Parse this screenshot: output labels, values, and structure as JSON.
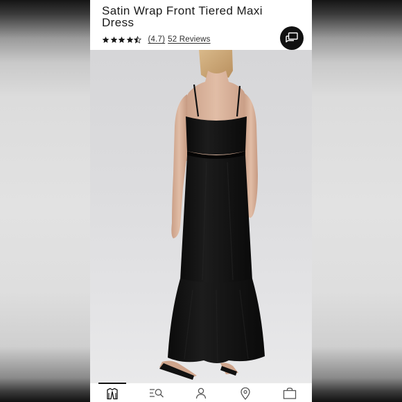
{
  "product": {
    "title": "Satin Wrap Front Tiered Maxi Dress",
    "rating_value": 4.7,
    "rating_text": "(4.7)",
    "reviews_text": "52 Reviews",
    "stars": [
      "full",
      "full",
      "full",
      "full",
      "half"
    ]
  },
  "colors": {
    "dress": "#111111",
    "accent": "#111111",
    "background": "#ffffff"
  },
  "icons": {
    "chat": "chat-bubbles-icon",
    "tabs": [
      "hanger-jacket-icon",
      "search-list-icon",
      "person-icon",
      "location-pin-icon",
      "shopping-bag-icon"
    ]
  },
  "tabbar": {
    "active_index": 0
  }
}
